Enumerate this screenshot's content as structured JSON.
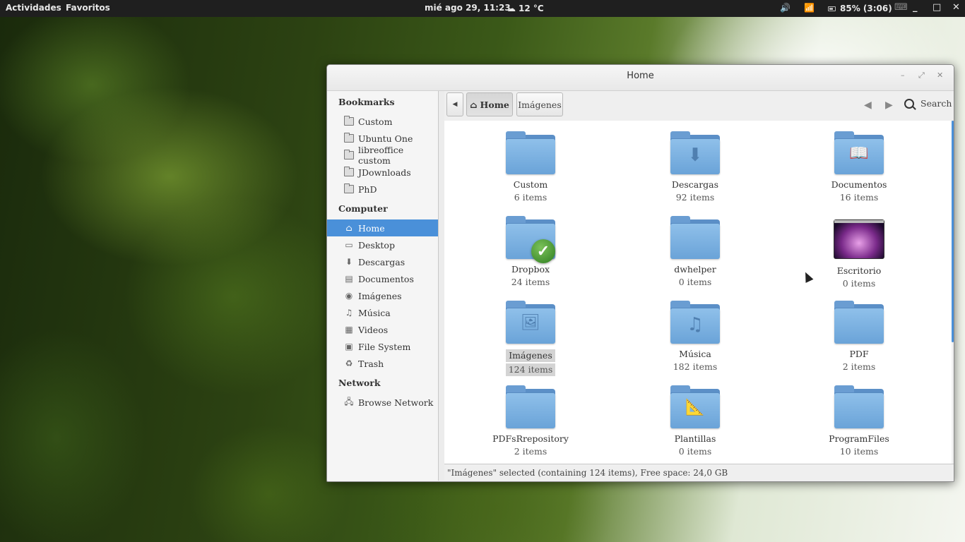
{
  "topbar": {
    "activities": "Actividades",
    "favorites": "Favoritos",
    "clock": "mié ago 29, 11:23",
    "weather": "12 °C",
    "battery": "85% (3:06)"
  },
  "window": {
    "title": "Home",
    "min": "–",
    "max": "⤢",
    "close": "✕"
  },
  "sidebar": {
    "bookmarks_heading": "Bookmarks",
    "bookmarks": [
      {
        "label": "Custom"
      },
      {
        "label": "Ubuntu One"
      },
      {
        "label": "libreoffice custom"
      },
      {
        "label": "JDownloads"
      },
      {
        "label": "PhD"
      }
    ],
    "computer_heading": "Computer",
    "computer": [
      {
        "label": "Home",
        "icon": "home-icon"
      },
      {
        "label": "Desktop",
        "icon": "desktop-icon"
      },
      {
        "label": "Descargas",
        "icon": "download-icon"
      },
      {
        "label": "Documentos",
        "icon": "document-icon"
      },
      {
        "label": "Imágenes",
        "icon": "camera-icon"
      },
      {
        "label": "Música",
        "icon": "music-icon"
      },
      {
        "label": "Videos",
        "icon": "film-icon"
      },
      {
        "label": "File System",
        "icon": "disk-icon"
      },
      {
        "label": "Trash",
        "icon": "trash-icon"
      }
    ],
    "network_heading": "Network",
    "network": [
      {
        "label": "Browse Network",
        "icon": "network-icon"
      }
    ]
  },
  "toolbar": {
    "home_label": "Home",
    "images_label": "Imágenes",
    "search_label": "Search"
  },
  "items": [
    {
      "name": "Custom",
      "count": "6 items",
      "glyph": ""
    },
    {
      "name": "Descargas",
      "count": "92 items",
      "glyph": "⬇"
    },
    {
      "name": "Documentos",
      "count": "16 items",
      "glyph": "📖"
    },
    {
      "name": "Dropbox",
      "count": "24 items",
      "glyph": ""
    },
    {
      "name": "dwhelper",
      "count": "0 items",
      "glyph": ""
    },
    {
      "name": "Escritorio",
      "count": "0 items",
      "glyph": ""
    },
    {
      "name": "Imágenes",
      "count": "124 items",
      "glyph": "🖼"
    },
    {
      "name": "Música",
      "count": "182 items",
      "glyph": "♫"
    },
    {
      "name": "PDF",
      "count": "2 items",
      "glyph": ""
    },
    {
      "name": "PDFsRrepository",
      "count": "2 items",
      "glyph": ""
    },
    {
      "name": "Plantillas",
      "count": "0 items",
      "glyph": "📐"
    },
    {
      "name": "ProgramFiles",
      "count": "10 items",
      "glyph": ""
    }
  ],
  "status": {
    "text": "\"Imágenes\" selected (containing 124 items), Free space: 24,0 GB"
  },
  "colors": {
    "accent": "#4a90d9",
    "folder": "#6aa3d8"
  }
}
